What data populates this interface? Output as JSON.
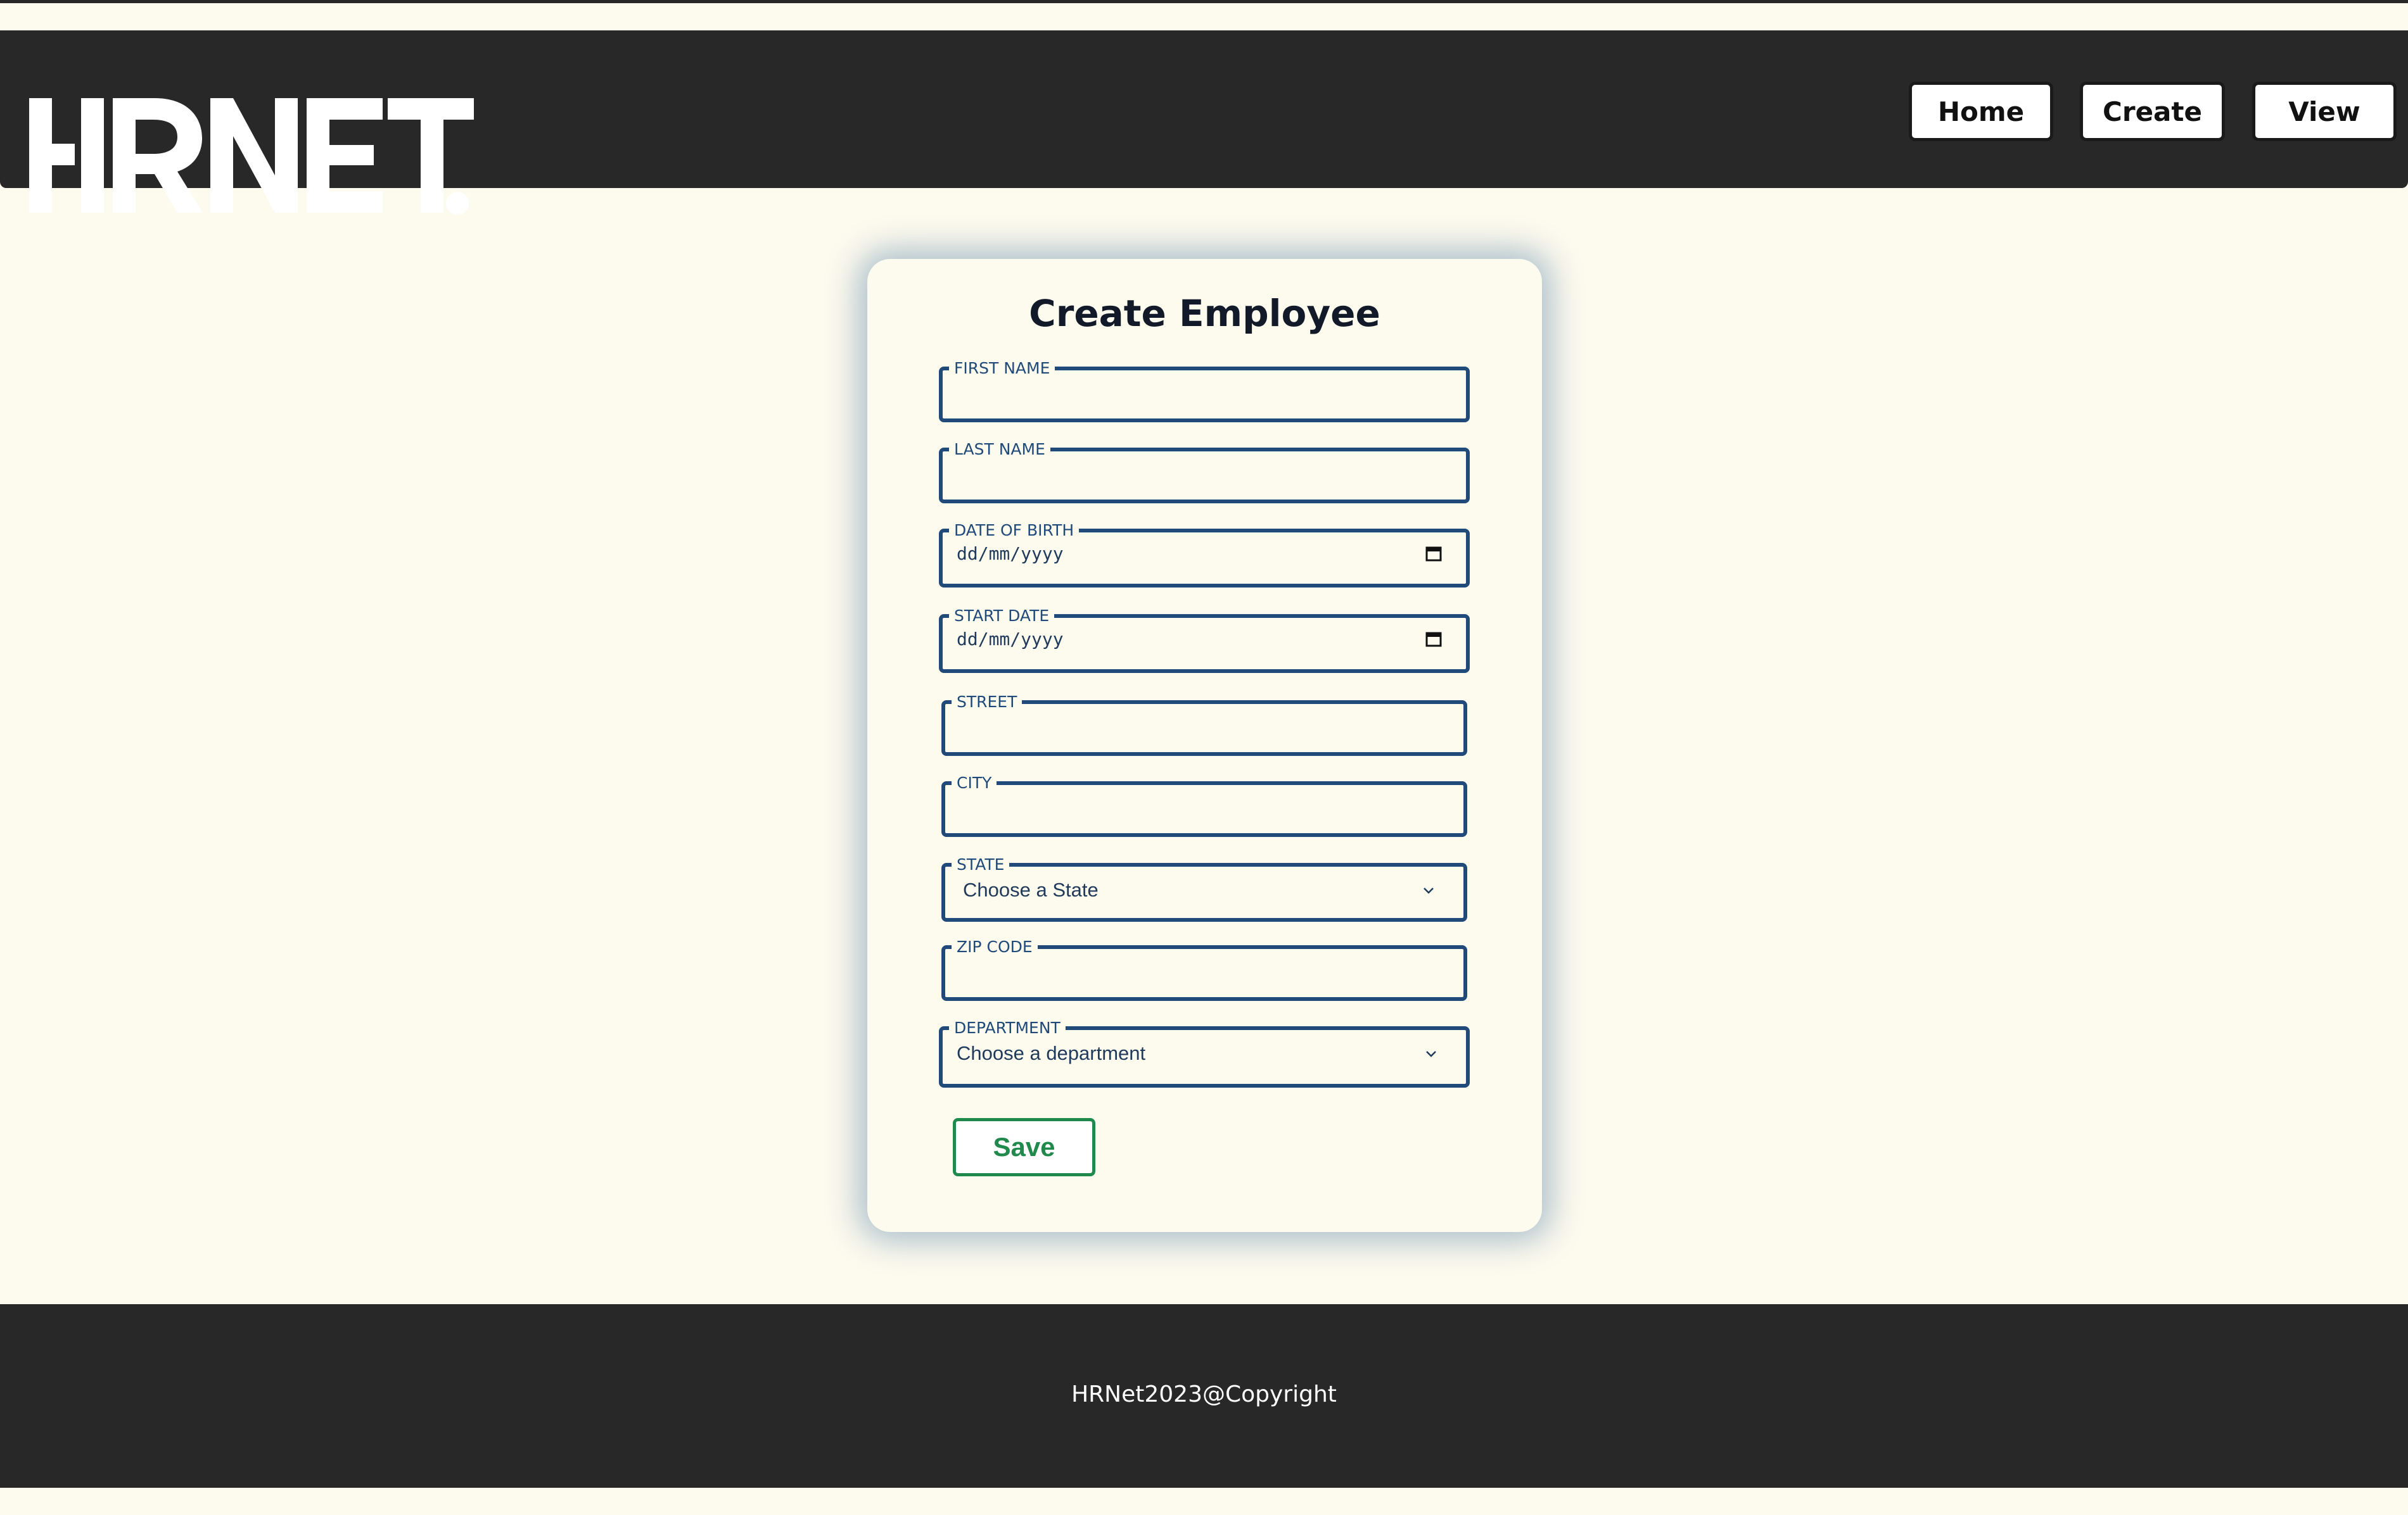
{
  "header": {
    "logo_text": "HRNET.",
    "nav": {
      "home": "Home",
      "create": "Create",
      "view": "View"
    }
  },
  "form": {
    "title": "Create Employee",
    "first_name": {
      "label": "FIRST NAME",
      "value": ""
    },
    "last_name": {
      "label": "LAST NAME",
      "value": ""
    },
    "date_of_birth": {
      "label": "DATE OF BIRTH",
      "placeholder": "dd/mm/yyyy"
    },
    "start_date": {
      "label": "START DATE",
      "placeholder": "dd/mm/yyyy"
    },
    "street": {
      "label": "STREET",
      "value": ""
    },
    "city": {
      "label": "CITY",
      "value": ""
    },
    "state": {
      "label": "STATE",
      "selected": "Choose a State"
    },
    "zip_code": {
      "label": "ZIP CODE",
      "value": ""
    },
    "department": {
      "label": "DEPARTMENT",
      "selected": "Choose a department"
    },
    "save_label": "Save"
  },
  "footer": {
    "text": "HRNet2023@Copyright"
  },
  "colors": {
    "background": "#fdfaee",
    "header": "#282828",
    "field_border": "#1f4a7a",
    "save_green": "#1f8a4c"
  },
  "icons": [
    "calendar-icon",
    "chevron-down-icon"
  ]
}
